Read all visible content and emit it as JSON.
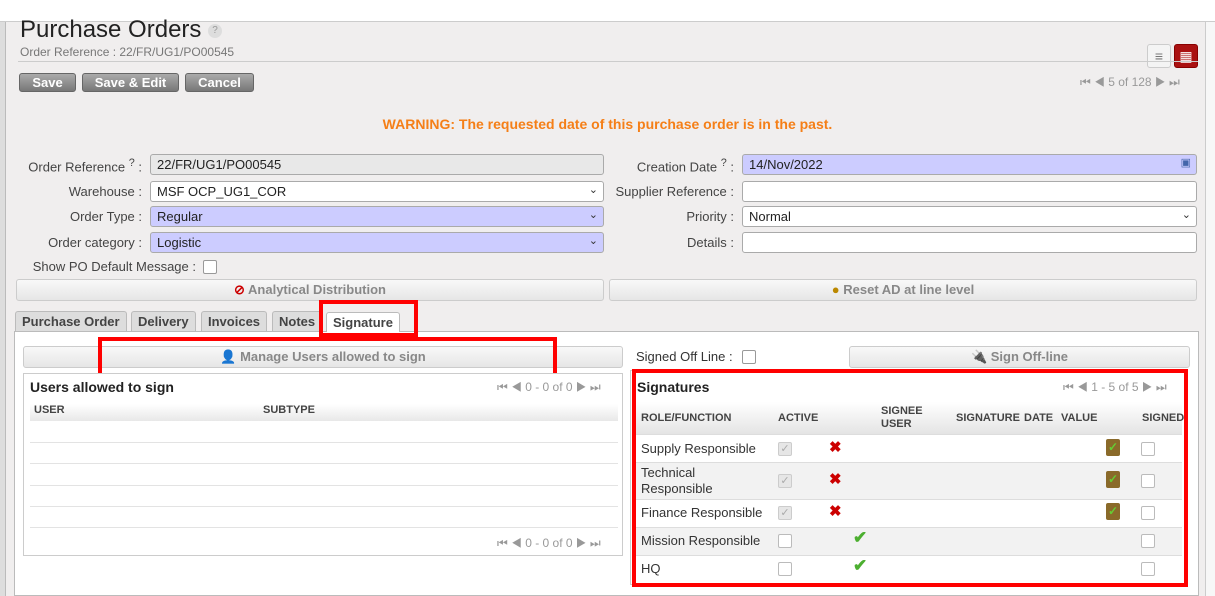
{
  "header": {
    "title": "Purchase Orders",
    "help": "?",
    "subtitle": "Order Reference : 22/FR/UG1/PO00545"
  },
  "toolbar": {
    "save": "Save",
    "save_edit": "Save & Edit",
    "cancel": "Cancel",
    "pager": "5 of 128"
  },
  "warning": "WARNING: The requested date of this purchase order is in the past.",
  "form": {
    "order_reference": {
      "label": "Order Reference",
      "help": "?",
      "value": "22/FR/UG1/PO00545"
    },
    "warehouse": {
      "label": "Warehouse :",
      "value": "MSF OCP_UG1_COR"
    },
    "order_type": {
      "label": "Order Type :",
      "value": "Regular"
    },
    "order_category": {
      "label": "Order category :",
      "value": "Logistic"
    },
    "show_po_default": {
      "label": "Show PO Default Message :",
      "checked": false
    },
    "creation_date": {
      "label": "Creation Date",
      "help": "?",
      "value": "14/Nov/2022"
    },
    "supplier_reference": {
      "label": "Supplier Reference :",
      "value": ""
    },
    "priority": {
      "label": "Priority :",
      "value": "Normal"
    },
    "details": {
      "label": "Details :",
      "value": ""
    },
    "analytical_distribution": "Analytical Distribution",
    "reset_ad": "Reset AD at line level"
  },
  "tabs": [
    "Purchase Order",
    "Delivery",
    "Invoices",
    "Notes",
    "Signature"
  ],
  "signature_tab": {
    "manage_users": "Manage Users allowed to sign",
    "signed_off_line": "Signed Off Line :",
    "sign_off_line": "Sign Off-line",
    "users_grid": {
      "title": "Users allowed to sign",
      "pager": "0 - 0 of 0",
      "columns": [
        "USER",
        "SUBTYPE"
      ],
      "footer_pager": "0 - 0 of 0"
    },
    "signatures_grid": {
      "title": "Signatures",
      "pager": "1 - 5 of 5",
      "columns": [
        "ROLE/FUNCTION",
        "ACTIVE",
        "SIGNEE USER",
        "SIGNATURE",
        "DATE",
        "VALUE",
        "SIGNED"
      ],
      "rows": [
        {
          "role": "Supply Responsible",
          "active": true,
          "status": "x"
        },
        {
          "role": "Technical Responsible",
          "active": true,
          "status": "x"
        },
        {
          "role": "Finance Responsible",
          "active": true,
          "status": "x"
        },
        {
          "role": "Mission Responsible",
          "active": false,
          "status": "ok"
        },
        {
          "role": "HQ",
          "active": false,
          "status": "ok"
        }
      ]
    }
  }
}
